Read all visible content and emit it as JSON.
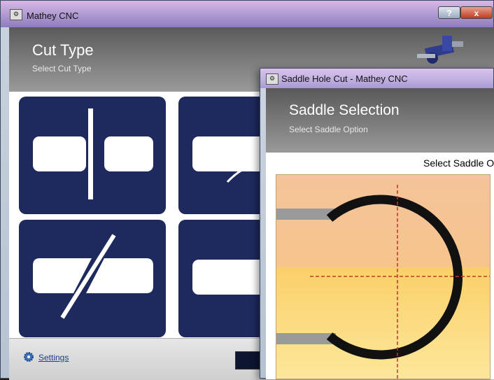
{
  "main_window": {
    "title": "Mathey CNC",
    "app_icon": "mathey-cnc-app-icon",
    "help_label": "?",
    "close_label": "x",
    "header": {
      "title": "Cut Type",
      "subtitle": "Select Cut Type"
    },
    "tiles": [
      {
        "name": "straight-cut",
        "icon": "straight-cut-icon"
      },
      {
        "name": "saddle-hole-cut",
        "icon": "saddle-cut-icon"
      },
      {
        "name": "miter-cut",
        "icon": "miter-cut-icon"
      },
      {
        "name": "end-cut",
        "icon": "end-cut-icon"
      }
    ],
    "footer": {
      "settings_label": "Settings",
      "settings_icon": "gear-icon"
    },
    "colors": {
      "tile": "#1e2a5e",
      "tile_shape": "#ffffff"
    }
  },
  "dialog": {
    "title": "Saddle Hole Cut - Mathey CNC",
    "header": {
      "title": "Saddle Selection",
      "subtitle": "Select Saddle Option"
    },
    "select_label": "Select Saddle O",
    "colors": {
      "ring": "#111111",
      "guide": "#c0392b",
      "pipe": "#9a9a9a"
    }
  }
}
